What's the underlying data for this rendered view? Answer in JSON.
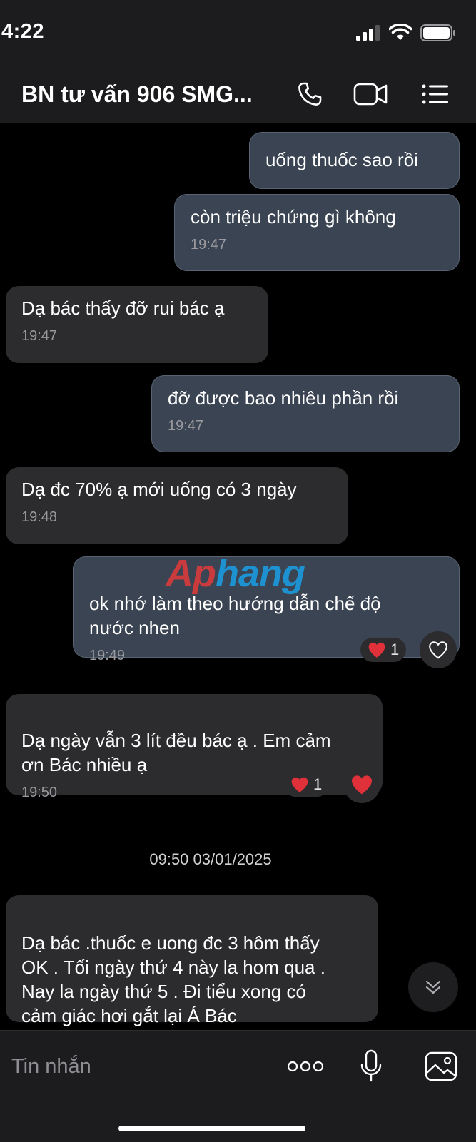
{
  "status_bar": {
    "time": "4:22"
  },
  "header": {
    "title": "BN tư vấn 906 SMG..."
  },
  "messages": [
    {
      "text": "uống thuốc sao  rồi"
    },
    {
      "text": "còn  triệu  chứng  gì  không",
      "time": "19:47"
    },
    {
      "text": "Dạ bác thấy đỡ rui bác ạ",
      "time": "19:47"
    },
    {
      "text": "đỡ  được  bao  nhiêu phần  rồi",
      "time": "19:47"
    },
    {
      "text": "Dạ đc 70% ạ mới uống có 3 ngày",
      "time": "19:48"
    },
    {
      "text": "ok  nhớ  làm theo hướng  dẫn  chế  độ\nnước nhen",
      "time": "19:49",
      "reaction_count": "1"
    },
    {
      "text": "Dạ ngày vẫn 3 lít đều bác ạ . Em cảm\nơn Bác nhiều ạ",
      "time": "19:50",
      "reaction_count": "1"
    },
    {
      "text": "Dạ bác .thuốc e uong đc 3 hôm thấy\nOK . Tối ngày thứ 4 này la hom qua .\nNay la  ngày thứ 5 . Đi tiểu xong có\ncảm giác hơi gắt lại Á Bác"
    }
  ],
  "date_divider": "09:50 03/01/2025",
  "watermark": {
    "part1": "Ap",
    "part2": "hang"
  },
  "composer": {
    "placeholder": "Tin nhắn"
  },
  "colors": {
    "outgoing_bubble": "#3a4452",
    "incoming_bubble": "#2c2c2e",
    "heart": "#e0303a"
  }
}
